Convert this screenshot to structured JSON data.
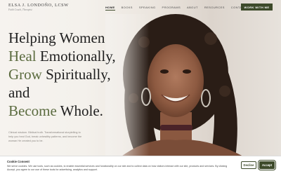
{
  "header": {
    "logo_name": "ELSA J. LONDOÑO, LCSW",
    "logo_tagline": "Faith Coach, Therapist",
    "nav": [
      "HOME",
      "BOOKS",
      "SPEAKING",
      "PROGRAMS",
      "ABOUT",
      "RESOURCES",
      "CONTACT"
    ],
    "active_nav": "HOME",
    "cta_label": "WORK WITH ME"
  },
  "hero": {
    "line1": "Helping Women",
    "line2_accent": "Heal",
    "line2_rest": " Emotionally,",
    "line3_accent": "Grow",
    "line3_rest": " Spiritually,",
    "line4": "and",
    "line5_accent": "Become",
    "line5_rest": " Whole.",
    "intro": "Clinical wisdom. Biblical truth. Transformational storytelling to help you heal God, break unhealthy patterns, and become the woman He created you to be."
  },
  "cookie": {
    "title": "Cookie Consent",
    "text": "We serve cookies. We use tools, such as cookies, to enable essential services and functionality on our site and to collect data on how visitors interact with our site, products and services. By clicking Accept, you agree to our use of these tools for advertising, analytics and support.",
    "decline_label": "Decline",
    "accept_label": "Accept"
  },
  "colors": {
    "brand_green": "#3d4a2a",
    "accent_green": "#5b6b3f",
    "background": "#f3f0ec"
  }
}
